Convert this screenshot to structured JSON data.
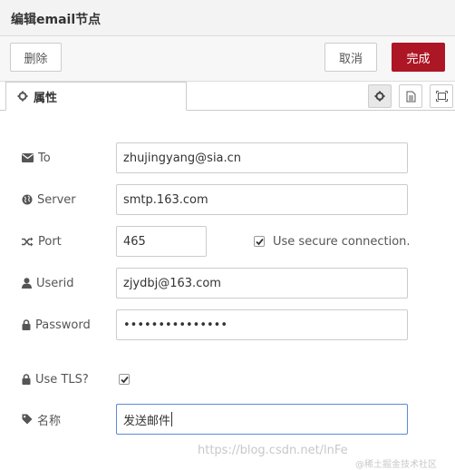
{
  "dialog": {
    "title": "编辑email节点"
  },
  "toolbar": {
    "delete_label": "删除",
    "cancel_label": "取消",
    "done_label": "完成"
  },
  "tabs": [
    {
      "label": "属性",
      "icon": "gear-icon"
    }
  ],
  "tab_buttons": [
    "gear-icon",
    "document-icon",
    "frame-icon"
  ],
  "form": {
    "to": {
      "label": "To",
      "icon": "envelope-icon",
      "value": "zhujingyang@sia.cn"
    },
    "server": {
      "label": "Server",
      "icon": "globe-icon",
      "value": "smtp.163.com"
    },
    "port": {
      "label": "Port",
      "icon": "random-icon",
      "value": "465"
    },
    "secure": {
      "label": "Use secure connection.",
      "checked": true
    },
    "userid": {
      "label": "Userid",
      "icon": "user-icon",
      "value": "zjydbj@163.com"
    },
    "password": {
      "label": "Password",
      "icon": "lock-icon",
      "value": "•••••••••••••••"
    },
    "tls": {
      "label": "Use TLS?",
      "icon": "lock-icon",
      "checked": true
    },
    "name": {
      "label": "名称",
      "icon": "tag-icon",
      "value": "发送邮件"
    }
  },
  "watermark": {
    "text": "https://blog.csdn.net/lnFe",
    "text2": "@稀土掘金技术社区"
  },
  "colors": {
    "primary": "#ad1625",
    "focus_border": "#5b8bd8"
  }
}
